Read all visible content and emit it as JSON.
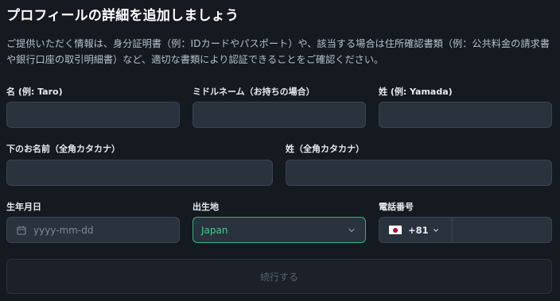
{
  "page": {
    "title": "プロフィールの詳細を追加しましょう",
    "description": "ご提供いただく情報は、身分証明書（例：IDカードやパスポート）や、該当する場合は住所確認書類（例：公共料金の請求書や銀行口座の取引明細書）など、適切な書類により認証できることをご確認ください。"
  },
  "form": {
    "first_name": {
      "label": "名 (例: Taro)",
      "value": ""
    },
    "middle_name": {
      "label": "ミドルネーム（お持ちの場合）",
      "value": ""
    },
    "last_name": {
      "label": "姓 (例: Yamada)",
      "value": ""
    },
    "first_name_kana": {
      "label": "下のお名前（全角カタカナ）",
      "value": ""
    },
    "last_name_kana": {
      "label": "姓（全角カタカナ）",
      "value": ""
    },
    "birth_date": {
      "label": "生年月日",
      "placeholder": "yyyy-mm-dd",
      "value": "",
      "icon": "calendar-icon"
    },
    "birthplace": {
      "label": "出生地",
      "selected": "Japan",
      "icon": "chevron-down-icon"
    },
    "phone": {
      "label": "電話番号",
      "country_flag": "japan-flag-icon",
      "dial_code": "+81",
      "value": ""
    },
    "submit_label": "続行する"
  },
  "colors": {
    "background": "#151a21",
    "field": "#2a323d",
    "field_border": "#3a4350",
    "accent": "#3ecf8e",
    "accent_border": "#2fb37a",
    "disabled_text": "#59616d"
  }
}
